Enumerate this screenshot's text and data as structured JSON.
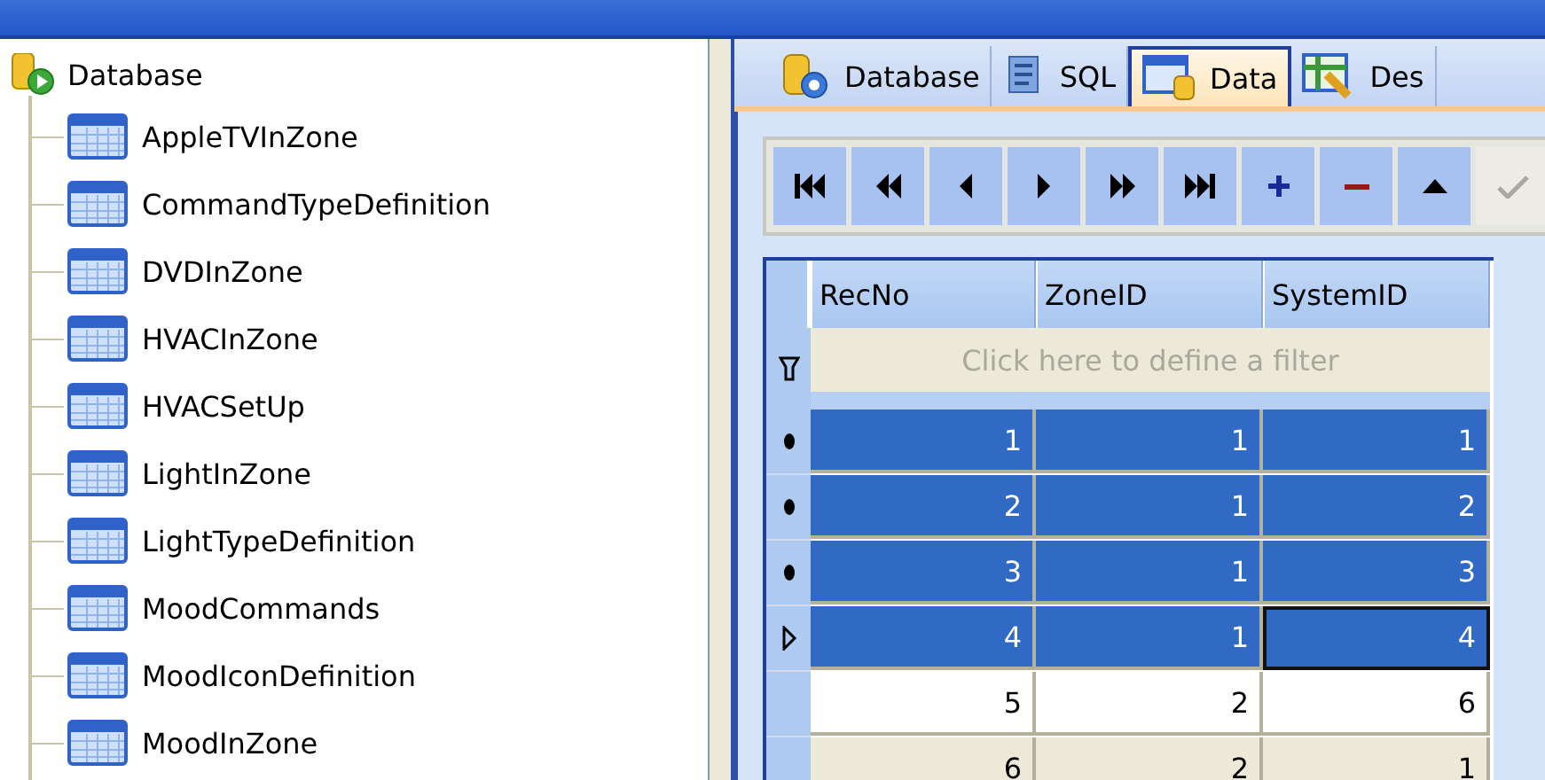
{
  "tree": {
    "root": {
      "label": "Database",
      "expanded": true
    },
    "children": [
      {
        "label": "AppleTVInZone"
      },
      {
        "label": "CommandTypeDefinition"
      },
      {
        "label": "DVDInZone"
      },
      {
        "label": "HVACInZone"
      },
      {
        "label": "HVACSetUp"
      },
      {
        "label": "LightInZone"
      },
      {
        "label": "LightTypeDefinition"
      },
      {
        "label": "MoodCommands"
      },
      {
        "label": "MoodIconDefinition"
      },
      {
        "label": "MoodInZone"
      }
    ]
  },
  "tabs": [
    {
      "label": "Database",
      "kind": "database",
      "selected": false
    },
    {
      "label": "SQL",
      "kind": "sql",
      "selected": false
    },
    {
      "label": "Data",
      "kind": "data",
      "selected": true
    },
    {
      "label": "Des",
      "kind": "design",
      "selected": false
    }
  ],
  "navigator": [
    {
      "kind": "first",
      "disabled": false
    },
    {
      "kind": "prior-page",
      "disabled": false
    },
    {
      "kind": "prior",
      "disabled": false
    },
    {
      "kind": "next",
      "disabled": false
    },
    {
      "kind": "next-page",
      "disabled": false
    },
    {
      "kind": "last",
      "disabled": false
    },
    {
      "kind": "insert",
      "disabled": false
    },
    {
      "kind": "delete",
      "disabled": false
    },
    {
      "kind": "edit",
      "disabled": false
    },
    {
      "kind": "post",
      "disabled": true
    }
  ],
  "grid": {
    "columns": [
      "RecNo",
      "ZoneID",
      "SystemID"
    ],
    "filter": {
      "placeholder": "Click here to define a filter"
    },
    "rows": [
      {
        "kind": "dot",
        "selected": true,
        "cells": [
          {
            "text": "1",
            "focused": false
          },
          {
            "text": "1",
            "focused": false
          },
          {
            "text": "1",
            "focused": false
          }
        ]
      },
      {
        "kind": "dot",
        "selected": true,
        "cells": [
          {
            "text": "2",
            "focused": false
          },
          {
            "text": "1",
            "focused": false
          },
          {
            "text": "2",
            "focused": false
          }
        ]
      },
      {
        "kind": "dot",
        "selected": true,
        "cells": [
          {
            "text": "3",
            "focused": false
          },
          {
            "text": "1",
            "focused": false
          },
          {
            "text": "3",
            "focused": false
          }
        ]
      },
      {
        "kind": "current",
        "selected": true,
        "cells": [
          {
            "text": "4",
            "focused": false
          },
          {
            "text": "1",
            "focused": false
          },
          {
            "text": "4",
            "focused": true
          }
        ]
      },
      {
        "kind": "plain",
        "selected": false,
        "cells": [
          {
            "text": "5",
            "focused": false
          },
          {
            "text": "2",
            "focused": false
          },
          {
            "text": "6",
            "focused": false
          }
        ]
      },
      {
        "kind": "plain",
        "selected": false,
        "cells": [
          {
            "text": "6",
            "focused": false
          },
          {
            "text": "2",
            "focused": false
          },
          {
            "text": "1",
            "focused": false
          }
        ]
      }
    ]
  }
}
